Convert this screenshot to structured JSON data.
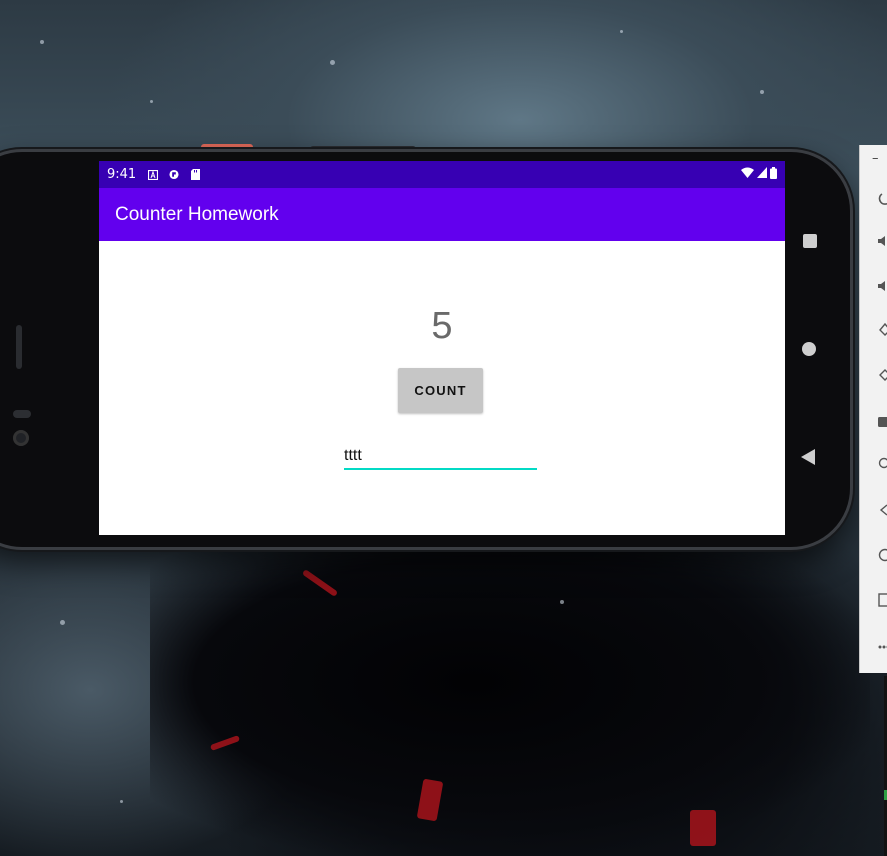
{
  "status_bar": {
    "time": "9:41",
    "left_icons": [
      "accessibility-a-icon",
      "media-icon",
      "sd-card-icon"
    ],
    "right_icons": [
      "wifi-icon",
      "signal-icon",
      "battery-icon"
    ]
  },
  "app_bar": {
    "title": "Counter Homework"
  },
  "counter": {
    "value": "5"
  },
  "count_button": {
    "label": "COUNT"
  },
  "text_field": {
    "value": "tttt"
  },
  "nav_bar": {
    "buttons": [
      "recents",
      "home",
      "back"
    ]
  },
  "emulator_toolbar": {
    "items": [
      "power-icon",
      "volume-up-icon",
      "volume-down-icon",
      "rotate-left-icon",
      "rotate-right-icon",
      "camera-icon",
      "zoom-icon",
      "back-icon",
      "home-icon",
      "overview-icon",
      "more-icon"
    ]
  },
  "colors": {
    "status_bar": "#3700b3",
    "app_bar": "#6200ee",
    "input_underline": "#03dac5",
    "button_bg": "#c6c6c6"
  }
}
